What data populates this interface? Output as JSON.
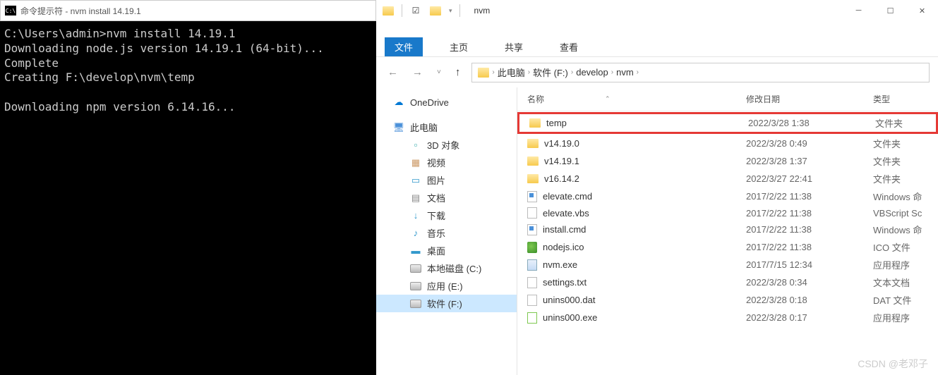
{
  "terminal": {
    "title": "命令提示符 - nvm  install 14.19.1",
    "lines": [
      "C:\\Users\\admin>nvm install 14.19.1",
      "Downloading node.js version 14.19.1 (64-bit)...",
      "Complete",
      "Creating F:\\develop\\nvm\\temp",
      "",
      "Downloading npm version 6.14.16..."
    ]
  },
  "explorer": {
    "qat_title": "nvm",
    "ribbon": {
      "file": "文件",
      "home": "主页",
      "share": "共享",
      "view": "查看"
    },
    "breadcrumb": [
      "此电脑",
      "软件 (F:)",
      "develop",
      "nvm"
    ],
    "sidebar": {
      "onedrive": "OneDrive",
      "thispc": "此电脑",
      "objects3d": "3D 对象",
      "videos": "视频",
      "pictures": "图片",
      "documents": "文档",
      "downloads": "下载",
      "music": "音乐",
      "desktop": "桌面",
      "diskc": "本地磁盘 (C:)",
      "diske": "应用 (E:)",
      "diskf": "软件 (F:)"
    },
    "columns": {
      "name": "名称",
      "date": "修改日期",
      "type": "类型"
    },
    "files": [
      {
        "name": "temp",
        "date": "2022/3/28 1:38",
        "type": "文件夹",
        "icon": "folder",
        "highlighted": true
      },
      {
        "name": "v14.19.0",
        "date": "2022/3/28 0:49",
        "type": "文件夹",
        "icon": "folder"
      },
      {
        "name": "v14.19.1",
        "date": "2022/3/28 1:37",
        "type": "文件夹",
        "icon": "folder"
      },
      {
        "name": "v16.14.2",
        "date": "2022/3/27 22:41",
        "type": "文件夹",
        "icon": "folder"
      },
      {
        "name": "elevate.cmd",
        "date": "2017/2/22 11:38",
        "type": "Windows 命",
        "icon": "cmd"
      },
      {
        "name": "elevate.vbs",
        "date": "2017/2/22 11:38",
        "type": "VBScript Sc",
        "icon": "file"
      },
      {
        "name": "install.cmd",
        "date": "2017/2/22 11:38",
        "type": "Windows 命",
        "icon": "cmd"
      },
      {
        "name": "nodejs.ico",
        "date": "2017/2/22 11:38",
        "type": "ICO 文件",
        "icon": "ico"
      },
      {
        "name": "nvm.exe",
        "date": "2017/7/15 12:34",
        "type": "应用程序",
        "icon": "exe"
      },
      {
        "name": "settings.txt",
        "date": "2022/3/28 0:34",
        "type": "文本文档",
        "icon": "file"
      },
      {
        "name": "unins000.dat",
        "date": "2022/3/28 0:18",
        "type": "DAT 文件",
        "icon": "file"
      },
      {
        "name": "unins000.exe",
        "date": "2022/3/28 0:17",
        "type": "应用程序",
        "icon": "green"
      }
    ]
  },
  "watermark": "CSDN @老邓子"
}
